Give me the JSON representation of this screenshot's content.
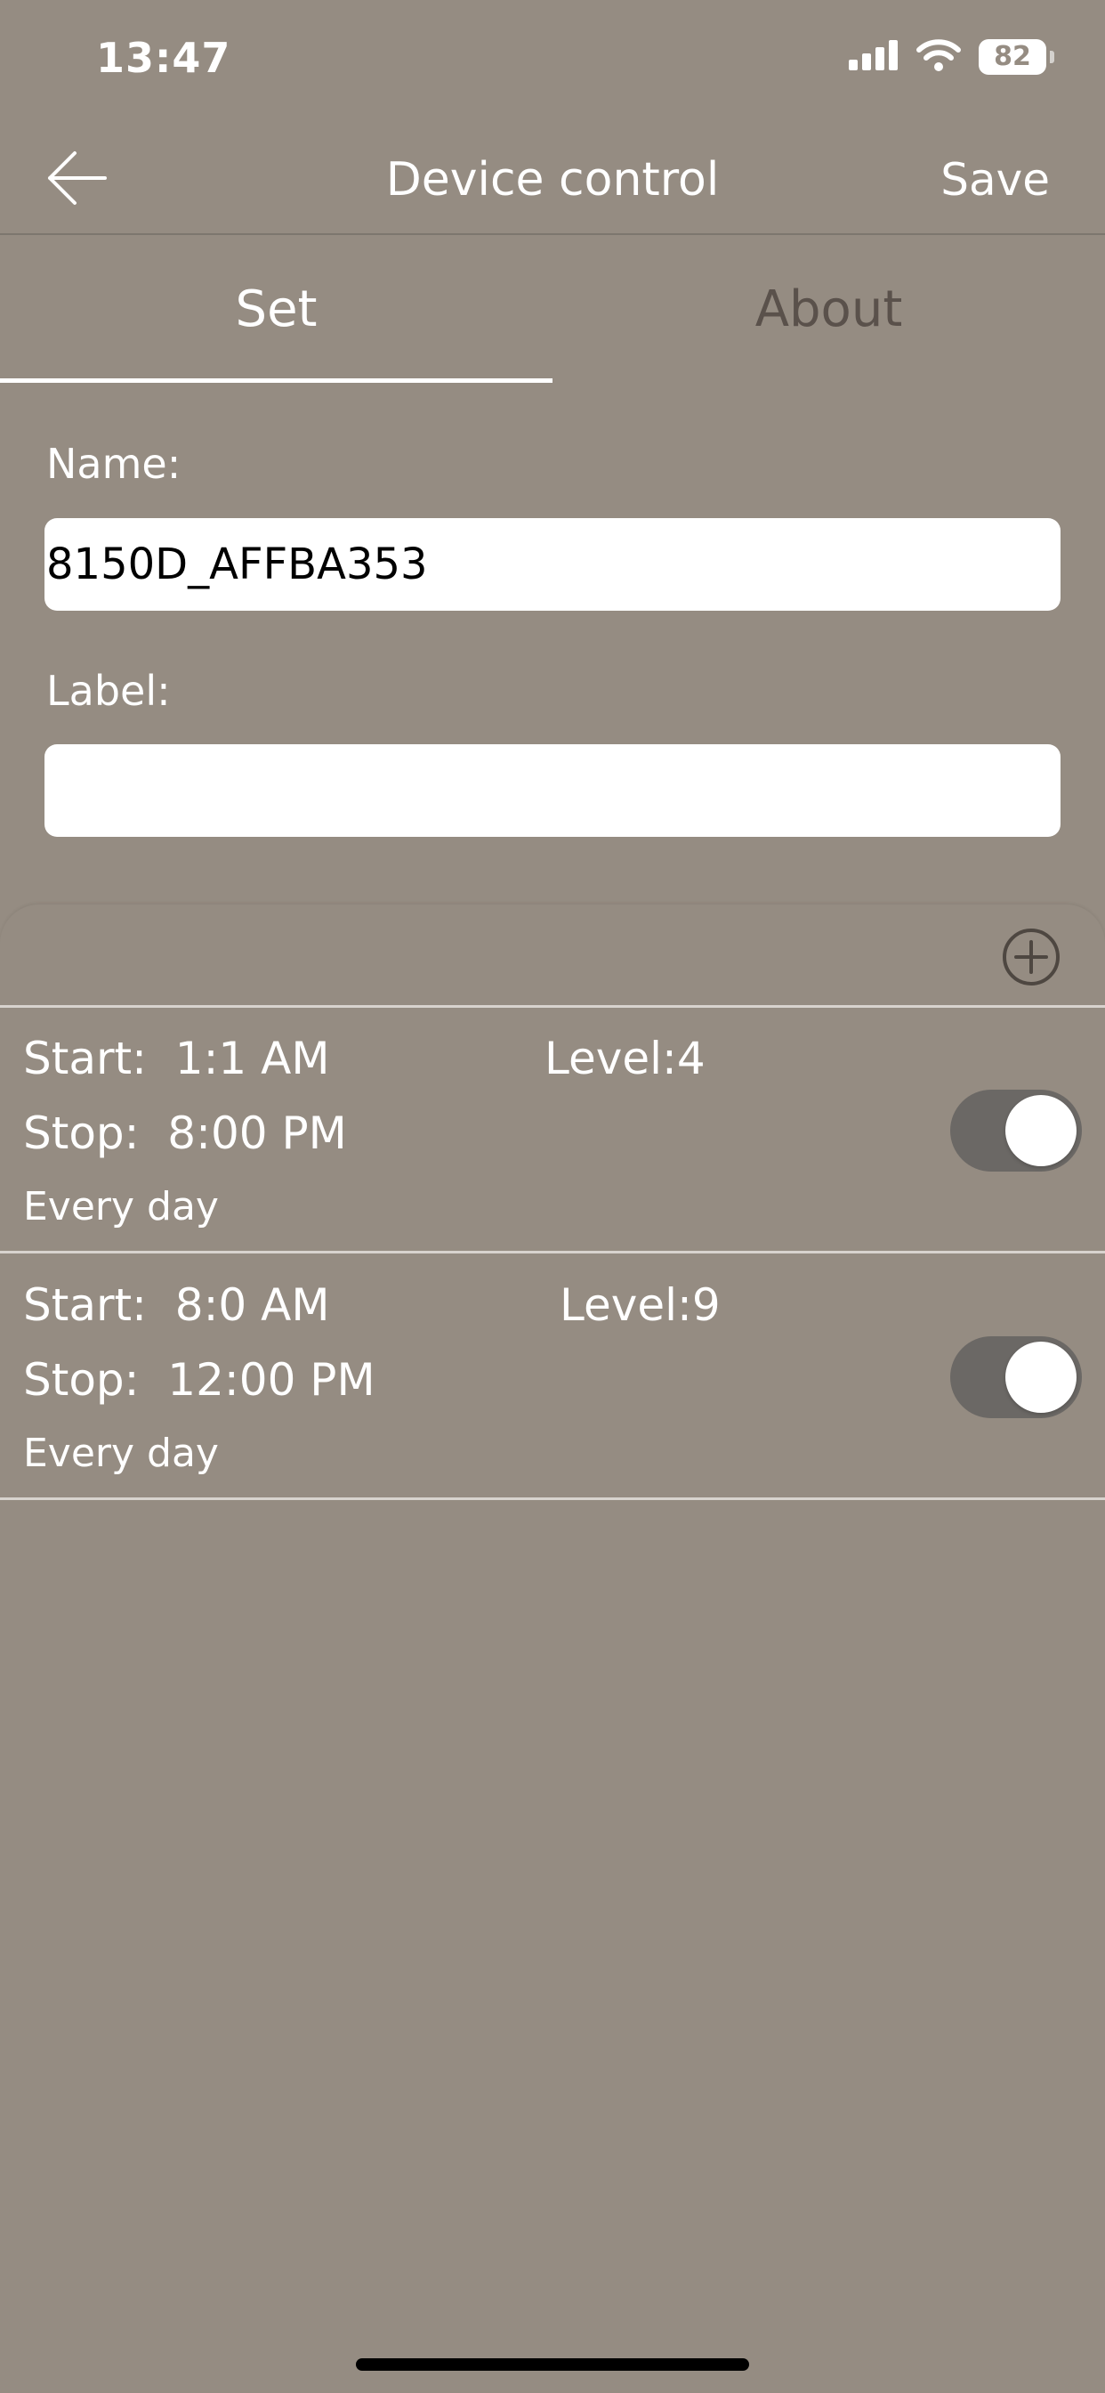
{
  "status_bar": {
    "time": "13:47",
    "battery_level": "82",
    "signal_icon": "cellular-signal-icon",
    "wifi_icon": "wifi-icon"
  },
  "header": {
    "back_icon": "arrow-left-icon",
    "title": "Device control",
    "save_label": "Save"
  },
  "tabs": [
    {
      "label": "Set",
      "active": true
    },
    {
      "label": "About",
      "active": false
    }
  ],
  "form": {
    "name_label": "Name:",
    "name_value": "8150D_AFFBA353",
    "label_label": "Label:",
    "label_value": ""
  },
  "schedule": {
    "add_icon": "plus-circle-icon",
    "items": [
      {
        "start": "Start:  1:1 AM",
        "stop": "Stop:  8:00 PM",
        "repeat": "Every day",
        "level": "Level:4",
        "enabled": true
      },
      {
        "start": "Start:  8:0 AM",
        "stop": "Stop:  12:00 PM",
        "repeat": "Every day",
        "level": "Level:9",
        "enabled": true
      }
    ]
  },
  "colors": {
    "background": "#958c82",
    "text": "#ffffff",
    "inactive_tab": "#5a514b",
    "toggle_track": "#6b6865",
    "divider": "#d8d3ce"
  }
}
